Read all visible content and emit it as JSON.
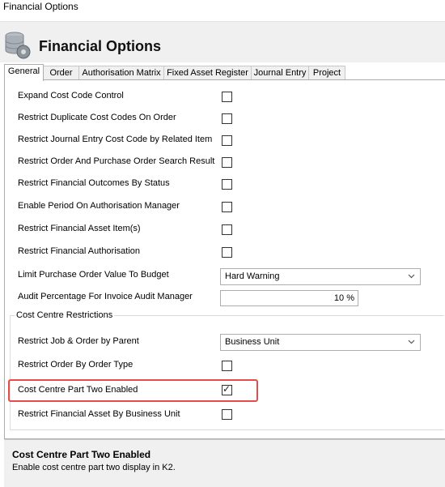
{
  "window": {
    "title": "Financial Options"
  },
  "header": {
    "title": "Financial Options",
    "icon": "database-gear-icon"
  },
  "tabs": [
    {
      "label": "General",
      "active": true
    },
    {
      "label": "Order",
      "active": false
    },
    {
      "label": "Authorisation Matrix",
      "active": false
    },
    {
      "label": "Fixed Asset Register",
      "active": false
    },
    {
      "label": "Journal Entry",
      "active": false
    },
    {
      "label": "Project",
      "active": false
    }
  ],
  "general": {
    "checkbox_rows": [
      {
        "label": "Expand Cost Code Control",
        "checked": false
      },
      {
        "label": "Restrict Duplicate Cost Codes On Order",
        "checked": false
      },
      {
        "label": "Restrict Journal Entry Cost Code by Related Item",
        "checked": false
      },
      {
        "label": "Restrict Order And Purchase Order Search Result",
        "checked": false
      },
      {
        "label": "Restrict Financial Outcomes By Status",
        "checked": false
      },
      {
        "label": "Enable Period On Authorisation Manager",
        "checked": false
      },
      {
        "label": "Restrict Financial Asset Item(s)",
        "checked": false
      },
      {
        "label": "Restrict Financial Authorisation",
        "checked": false
      }
    ],
    "limit_po": {
      "label": "Limit Purchase Order Value To Budget",
      "value": "Hard Warning"
    },
    "audit_pct": {
      "label": "Audit Percentage For Invoice Audit Manager",
      "value": "10 %"
    }
  },
  "cost_centre": {
    "group_label": "Cost Centre Restrictions",
    "restrict_job": {
      "label": "Restrict Job & Order by Parent",
      "value": "Business Unit"
    },
    "restrict_order_type": {
      "label": "Restrict Order By Order Type",
      "checked": false
    },
    "part_two": {
      "label": "Cost Centre Part Two Enabled",
      "checked": true
    },
    "restrict_asset_bu": {
      "label": "Restrict Financial Asset By Business Unit",
      "checked": false
    }
  },
  "description": {
    "title": "Cost Centre Part Two Enabled",
    "text": "Enable cost centre part two display in K2."
  },
  "colors": {
    "highlight": "#e74c4c",
    "panel_bg": "#f0f0f0"
  }
}
